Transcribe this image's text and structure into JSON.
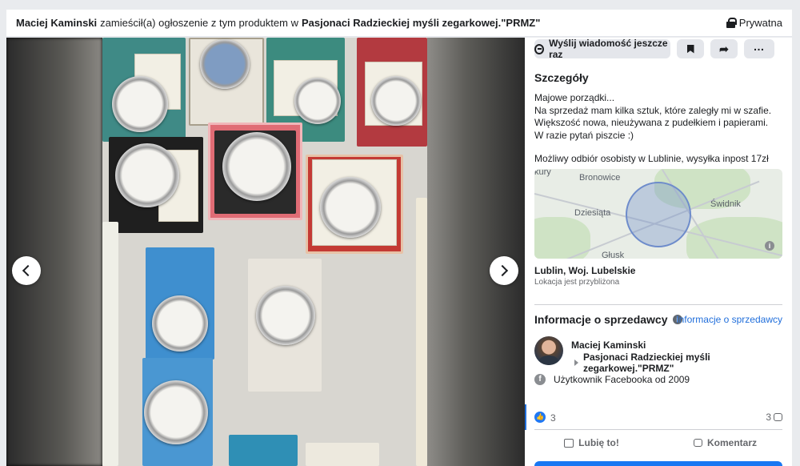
{
  "header": {
    "author": "Maciej Kaminski",
    "action": "zamieścił(a) ogłoszenie z tym produktem w",
    "group": "Pasjonaci Radzieckiej myśli zegarkowej.\"PRMZ\"",
    "privacy": "Prywatna"
  },
  "actions": {
    "send_again": "Wyślij wiadomość jeszcze raz"
  },
  "details": {
    "title": "Szczegóły",
    "description": [
      "Majowe porządki...",
      "Na sprzedaż mam kilka sztuk, które zaległy mi w szafie.",
      "Większość nowa, nieużywana z pudełkiem i papierami.",
      "W razie pytań piszcie  :)"
    ],
    "pickup": "Możliwy odbiór osobisty w Lublinie, wysyłka inpost 17zł"
  },
  "map": {
    "labels": [
      "Bronowice",
      "Dziesiąta",
      "Świdnik",
      "Głusk",
      "kury"
    ]
  },
  "location": {
    "name": "Lublin, Woj. Lubelskie",
    "note": "Lokacja jest przybliżona"
  },
  "seller": {
    "heading": "Informacje o sprzedawcy",
    "link": "Informacje o sprzedawcy",
    "name": "Maciej Kaminski",
    "group": "Pasjonaci Radzieckiej myśli zegarkowej.\"PRMZ\"",
    "member_since": "Użytkownik Facebooka od 2009"
  },
  "reactions": {
    "likes": "3",
    "comments": "3",
    "like_label": "Lubię to!",
    "comment_label": "Komentarz"
  }
}
